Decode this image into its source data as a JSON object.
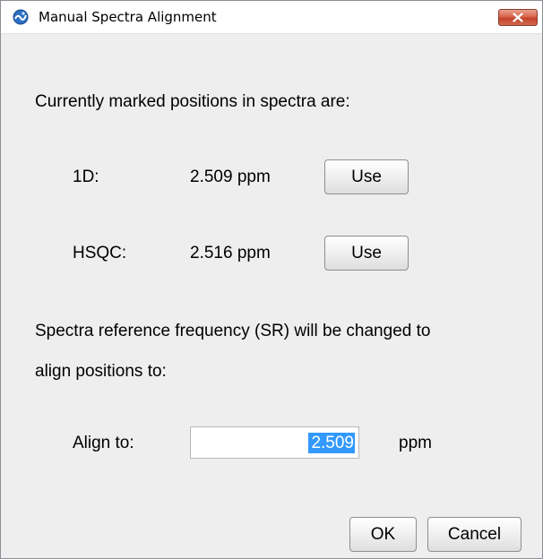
{
  "window": {
    "title": "Manual Spectra Alignment"
  },
  "dialog": {
    "intro_text": "Currently marked positions in spectra are:",
    "positions": [
      {
        "label": "1D:",
        "value": "2.509 ppm",
        "button": "Use"
      },
      {
        "label": "HSQC:",
        "value": "2.516 ppm",
        "button": "Use"
      }
    ],
    "note_line1": "Spectra reference frequency (SR) will be changed to",
    "note_line2": "align positions to:",
    "align": {
      "label": "Align to:",
      "value": "2.509",
      "unit": "ppm"
    },
    "ok_label": "OK",
    "cancel_label": "Cancel"
  },
  "colors": {
    "selection": "#3399ff",
    "close_button": "#c94a32",
    "background": "#eeeeee"
  },
  "icons": {
    "app": "spectrum-app-icon",
    "close": "close-icon"
  }
}
